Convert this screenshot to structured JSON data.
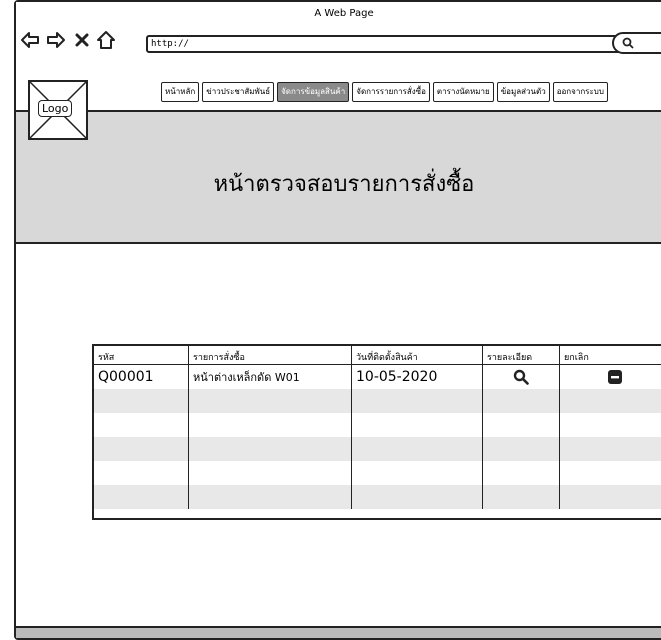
{
  "window": {
    "title": "A Web Page",
    "url": "http://"
  },
  "logo": {
    "label": "Logo"
  },
  "menu": {
    "items": [
      {
        "label": "หน้าหลัก"
      },
      {
        "label": "ข่าวประชาสัมพันธ์"
      },
      {
        "label": "จัดการข้อมูลสินค้า"
      },
      {
        "label": "จัดการรายการสั่งซื้อ"
      },
      {
        "label": "ตารางนัดหมาย"
      },
      {
        "label": "ข้อมูลส่วนตัว"
      },
      {
        "label": "ออกจากระบบ"
      }
    ],
    "active_index": 2
  },
  "page": {
    "heading": "หน้าตรวจสอบรายการสั่งซื้อ"
  },
  "table": {
    "headers": [
      "รหัส",
      "รายการสั่งซื้อ",
      "วันที่ติดตั้งสินค้า",
      "รายละเอียด",
      "ยกเลิก"
    ],
    "rows": [
      {
        "id": "Q00001",
        "item": "หน้าต่างเหล็กดัด W01",
        "date": "10-05-2020",
        "detail_icon": "search-icon",
        "cancel_icon": "minus-box-icon"
      }
    ],
    "empty_rows": 5
  }
}
